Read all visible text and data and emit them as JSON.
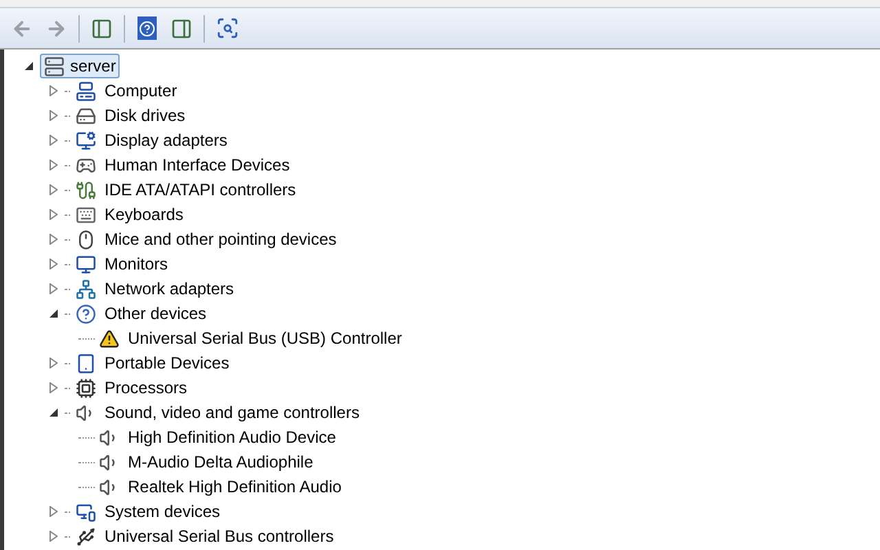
{
  "tree": {
    "label": "server",
    "expanded": true,
    "selected": true,
    "children": [
      {
        "label": "Computer",
        "expanded": false
      },
      {
        "label": "Disk drives",
        "expanded": false
      },
      {
        "label": "Display adapters",
        "expanded": false
      },
      {
        "label": "Human Interface Devices",
        "expanded": false
      },
      {
        "label": "IDE ATA/ATAPI controllers",
        "expanded": false
      },
      {
        "label": "Keyboards",
        "expanded": false
      },
      {
        "label": "Mice and other pointing devices",
        "expanded": false
      },
      {
        "label": "Monitors",
        "expanded": false
      },
      {
        "label": "Network adapters",
        "expanded": false
      },
      {
        "label": "Other devices",
        "expanded": true,
        "children": [
          {
            "label": "Universal Serial Bus (USB) Controller",
            "warning": true
          }
        ]
      },
      {
        "label": "Portable Devices",
        "expanded": false
      },
      {
        "label": "Processors",
        "expanded": false
      },
      {
        "label": "Sound, video and game controllers",
        "expanded": true,
        "children": [
          {
            "label": "High Definition Audio Device",
            "warning": false
          },
          {
            "label": "M-Audio Delta Audiophile",
            "warning": false
          },
          {
            "label": "Realtek High Definition Audio",
            "warning": false
          }
        ]
      },
      {
        "label": "System devices",
        "expanded": false
      },
      {
        "label": "Universal Serial Bus controllers",
        "expanded": false
      }
    ]
  }
}
